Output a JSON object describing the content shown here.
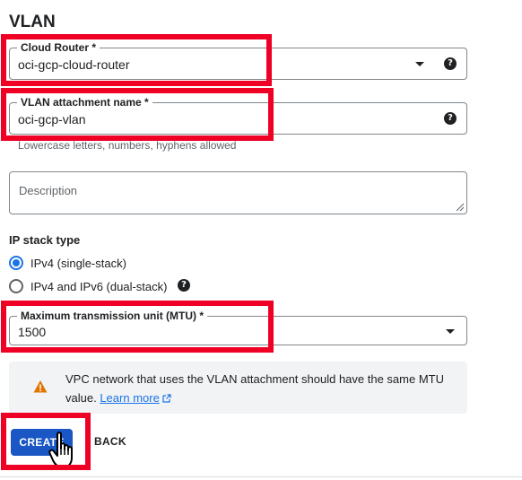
{
  "section": {
    "title": "VLAN"
  },
  "cloud_router": {
    "label": "Cloud Router *",
    "value": "oci-gcp-cloud-router"
  },
  "vlan_name": {
    "label": "VLAN attachment name *",
    "value": "oci-gcp-vlan",
    "hint": "Lowercase letters, numbers, hyphens allowed"
  },
  "description": {
    "placeholder": "Description"
  },
  "ip_stack": {
    "title": "IP stack type",
    "options": [
      {
        "label": "IPv4 (single-stack)",
        "selected": true
      },
      {
        "label": "IPv4 and IPv6 (dual-stack)",
        "selected": false
      }
    ]
  },
  "mtu": {
    "label": "Maximum transmission unit (MTU) *",
    "value": "1500"
  },
  "warning": {
    "text": "VPC network that uses the VLAN attachment should have the same MTU value.",
    "link": "Learn more"
  },
  "actions": {
    "create": "CREATE",
    "back": "BACK"
  },
  "icons": {
    "help": "help-icon",
    "dropdown": "caret-down-icon",
    "warning": "warning-icon",
    "external": "external-link-icon",
    "cursor": "hand-pointer-cursor-icon"
  },
  "colors": {
    "highlight": "#ef0025",
    "primary": "#1a56c4",
    "link": "#1a73e8",
    "warning": "#e37400"
  }
}
